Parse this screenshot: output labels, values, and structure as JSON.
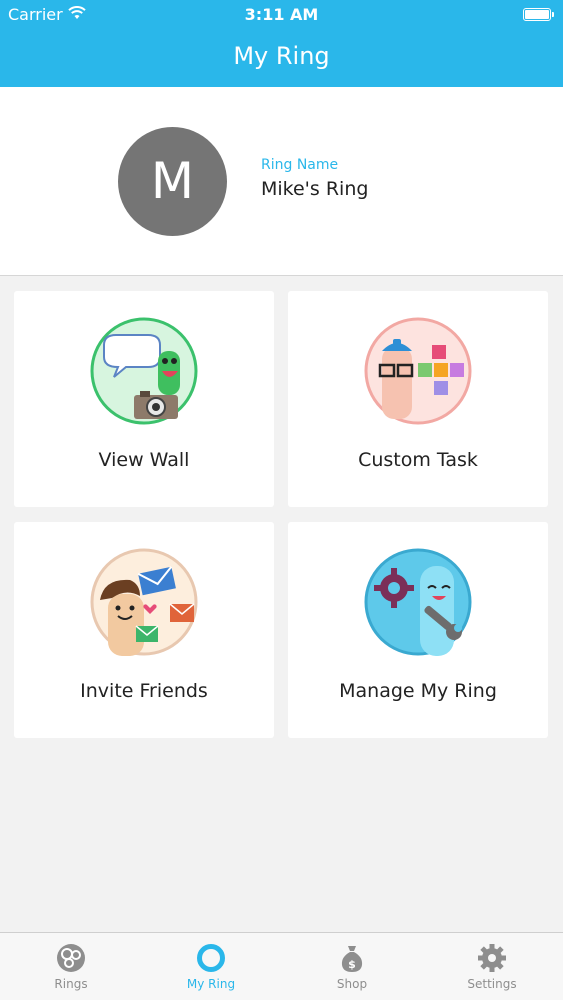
{
  "status_bar": {
    "carrier": "Carrier",
    "time": "3:11 AM"
  },
  "nav": {
    "title": "My Ring"
  },
  "profile": {
    "avatar_initial": "M",
    "ring_label": "Ring Name",
    "ring_name": "Mike's Ring"
  },
  "tiles": [
    {
      "label": "View Wall",
      "icon": "speech-bubble-camera-icon"
    },
    {
      "label": "Custom Task",
      "icon": "puzzle-pieces-icon"
    },
    {
      "label": "Invite Friends",
      "icon": "envelopes-icon"
    },
    {
      "label": "Manage My Ring",
      "icon": "gear-wrench-icon"
    }
  ],
  "tab_bar": {
    "items": [
      {
        "label": "Rings",
        "icon": "rings-icon"
      },
      {
        "label": "My Ring",
        "icon": "ring-circle-icon",
        "active": true
      },
      {
        "label": "Shop",
        "icon": "money-bag-icon"
      },
      {
        "label": "Settings",
        "icon": "gear-icon"
      }
    ]
  },
  "colors": {
    "accent": "#2ab7ea",
    "avatar": "#757575",
    "background": "#f2f2f2"
  }
}
